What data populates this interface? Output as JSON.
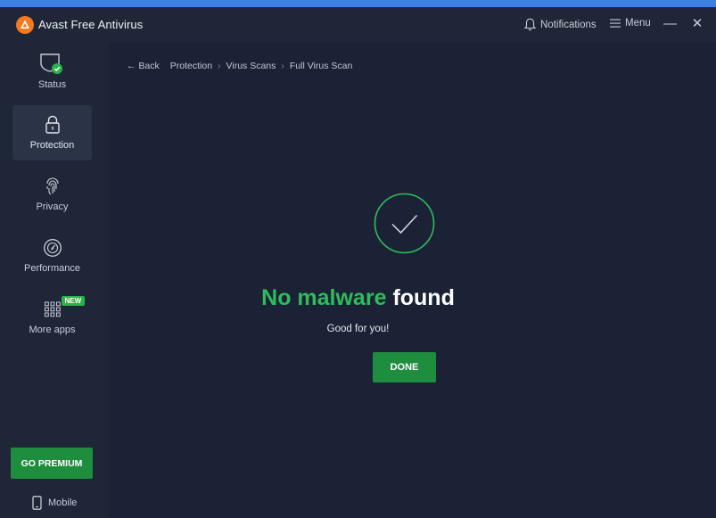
{
  "window": {
    "title": "Avast Free Antivirus",
    "notifications_label": "Notifications",
    "menu_label": "Menu",
    "minimize_glyph": "—",
    "close_glyph": "✕",
    "accent_color": "#3f7ee5",
    "logo_color": "#f47a20"
  },
  "sidebar": {
    "items": [
      {
        "label": "Status",
        "icon": "shield-check-icon",
        "active": false
      },
      {
        "label": "Protection",
        "icon": "lock-icon",
        "active": true
      },
      {
        "label": "Privacy",
        "icon": "fingerprint-icon",
        "active": false
      },
      {
        "label": "Performance",
        "icon": "speedometer-icon",
        "active": false
      },
      {
        "label": "More apps",
        "icon": "apps-grid-icon",
        "active": false,
        "badge": "NEW"
      }
    ],
    "premium_label": "GO PREMIUM",
    "mobile_label": "Mobile"
  },
  "breadcrumb": {
    "back": "← Back",
    "items": [
      "Protection",
      "Virus Scans",
      "Full Virus Scan"
    ],
    "separator": "›"
  },
  "result": {
    "title_green": "No malware",
    "title_white": "found",
    "subtitle": "Good for you!",
    "done_label": "DONE",
    "success_color": "#2fbc5b"
  }
}
